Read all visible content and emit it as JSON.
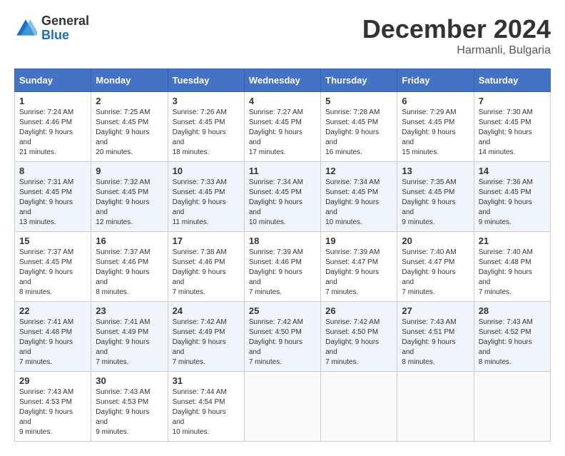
{
  "logo": {
    "general": "General",
    "blue": "Blue"
  },
  "title": {
    "month": "December 2024",
    "location": "Harmanli, Bulgaria"
  },
  "weekdays": [
    "Sunday",
    "Monday",
    "Tuesday",
    "Wednesday",
    "Thursday",
    "Friday",
    "Saturday"
  ],
  "weeks": [
    [
      {
        "day": "1",
        "sunrise": "7:24 AM",
        "sunset": "4:46 PM",
        "daylight": "9 hours and 21 minutes."
      },
      {
        "day": "2",
        "sunrise": "7:25 AM",
        "sunset": "4:45 PM",
        "daylight": "9 hours and 20 minutes."
      },
      {
        "day": "3",
        "sunrise": "7:26 AM",
        "sunset": "4:45 PM",
        "daylight": "9 hours and 18 minutes."
      },
      {
        "day": "4",
        "sunrise": "7:27 AM",
        "sunset": "4:45 PM",
        "daylight": "9 hours and 17 minutes."
      },
      {
        "day": "5",
        "sunrise": "7:28 AM",
        "sunset": "4:45 PM",
        "daylight": "9 hours and 16 minutes."
      },
      {
        "day": "6",
        "sunrise": "7:29 AM",
        "sunset": "4:45 PM",
        "daylight": "9 hours and 15 minutes."
      },
      {
        "day": "7",
        "sunrise": "7:30 AM",
        "sunset": "4:45 PM",
        "daylight": "9 hours and 14 minutes."
      }
    ],
    [
      {
        "day": "8",
        "sunrise": "7:31 AM",
        "sunset": "4:45 PM",
        "daylight": "9 hours and 13 minutes."
      },
      {
        "day": "9",
        "sunrise": "7:32 AM",
        "sunset": "4:45 PM",
        "daylight": "9 hours and 12 minutes."
      },
      {
        "day": "10",
        "sunrise": "7:33 AM",
        "sunset": "4:45 PM",
        "daylight": "9 hours and 11 minutes."
      },
      {
        "day": "11",
        "sunrise": "7:34 AM",
        "sunset": "4:45 PM",
        "daylight": "9 hours and 10 minutes."
      },
      {
        "day": "12",
        "sunrise": "7:34 AM",
        "sunset": "4:45 PM",
        "daylight": "9 hours and 10 minutes."
      },
      {
        "day": "13",
        "sunrise": "7:35 AM",
        "sunset": "4:45 PM",
        "daylight": "9 hours and 9 minutes."
      },
      {
        "day": "14",
        "sunrise": "7:36 AM",
        "sunset": "4:45 PM",
        "daylight": "9 hours and 9 minutes."
      }
    ],
    [
      {
        "day": "15",
        "sunrise": "7:37 AM",
        "sunset": "4:45 PM",
        "daylight": "9 hours and 8 minutes."
      },
      {
        "day": "16",
        "sunrise": "7:37 AM",
        "sunset": "4:46 PM",
        "daylight": "9 hours and 8 minutes."
      },
      {
        "day": "17",
        "sunrise": "7:38 AM",
        "sunset": "4:46 PM",
        "daylight": "9 hours and 7 minutes."
      },
      {
        "day": "18",
        "sunrise": "7:39 AM",
        "sunset": "4:46 PM",
        "daylight": "9 hours and 7 minutes."
      },
      {
        "day": "19",
        "sunrise": "7:39 AM",
        "sunset": "4:47 PM",
        "daylight": "9 hours and 7 minutes."
      },
      {
        "day": "20",
        "sunrise": "7:40 AM",
        "sunset": "4:47 PM",
        "daylight": "9 hours and 7 minutes."
      },
      {
        "day": "21",
        "sunrise": "7:40 AM",
        "sunset": "4:48 PM",
        "daylight": "9 hours and 7 minutes."
      }
    ],
    [
      {
        "day": "22",
        "sunrise": "7:41 AM",
        "sunset": "4:48 PM",
        "daylight": "9 hours and 7 minutes."
      },
      {
        "day": "23",
        "sunrise": "7:41 AM",
        "sunset": "4:49 PM",
        "daylight": "9 hours and 7 minutes."
      },
      {
        "day": "24",
        "sunrise": "7:42 AM",
        "sunset": "4:49 PM",
        "daylight": "9 hours and 7 minutes."
      },
      {
        "day": "25",
        "sunrise": "7:42 AM",
        "sunset": "4:50 PM",
        "daylight": "9 hours and 7 minutes."
      },
      {
        "day": "26",
        "sunrise": "7:42 AM",
        "sunset": "4:50 PM",
        "daylight": "9 hours and 7 minutes."
      },
      {
        "day": "27",
        "sunrise": "7:43 AM",
        "sunset": "4:51 PM",
        "daylight": "9 hours and 8 minutes."
      },
      {
        "day": "28",
        "sunrise": "7:43 AM",
        "sunset": "4:52 PM",
        "daylight": "9 hours and 8 minutes."
      }
    ],
    [
      {
        "day": "29",
        "sunrise": "7:43 AM",
        "sunset": "4:53 PM",
        "daylight": "9 hours and 9 minutes."
      },
      {
        "day": "30",
        "sunrise": "7:43 AM",
        "sunset": "4:53 PM",
        "daylight": "9 hours and 9 minutes."
      },
      {
        "day": "31",
        "sunrise": "7:44 AM",
        "sunset": "4:54 PM",
        "daylight": "9 hours and 10 minutes."
      },
      null,
      null,
      null,
      null
    ]
  ],
  "labels": {
    "sunrise": "Sunrise:",
    "sunset": "Sunset:",
    "daylight": "Daylight:"
  }
}
